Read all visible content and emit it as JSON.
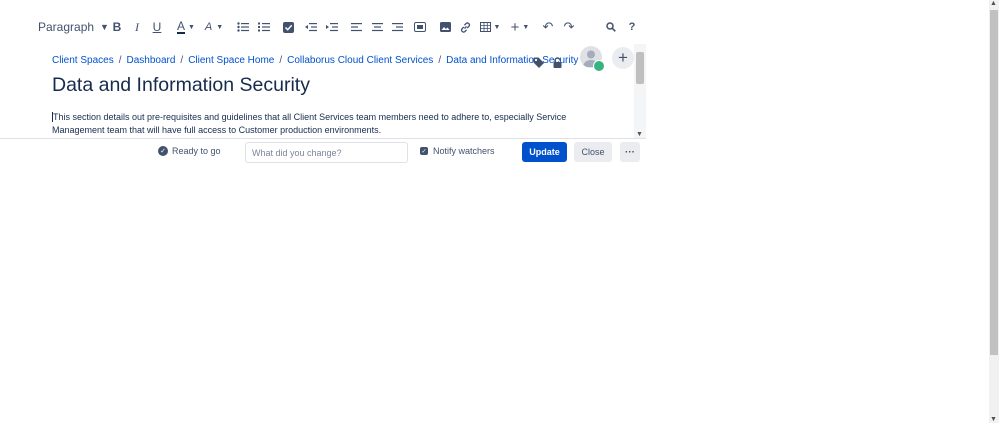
{
  "toolbar": {
    "paragraph_label": "Paragraph",
    "help_label": "?"
  },
  "breadcrumb": [
    "Client Spaces",
    "Dashboard",
    "Client Space Home",
    "Collaborus Cloud Client Services",
    "Data and Information Security"
  ],
  "breadcrumb_separator": "/",
  "page": {
    "title": "Data and Information Security",
    "body": "This section details out pre-requisites and guidelines that all Client Services team members need to adhere to, especially Service Management team that will have full access to Customer production environments."
  },
  "footer": {
    "ready_label": "Ready to go",
    "change_placeholder": "What did you change?",
    "notify_label": "Notify watchers",
    "notify_checked": true,
    "update_label": "Update",
    "close_label": "Close",
    "more_label": "···"
  },
  "colors": {
    "primary": "#0052cc",
    "text": "#172b4d",
    "subtle": "#42526e",
    "avatar_badge": "#36b37e"
  }
}
